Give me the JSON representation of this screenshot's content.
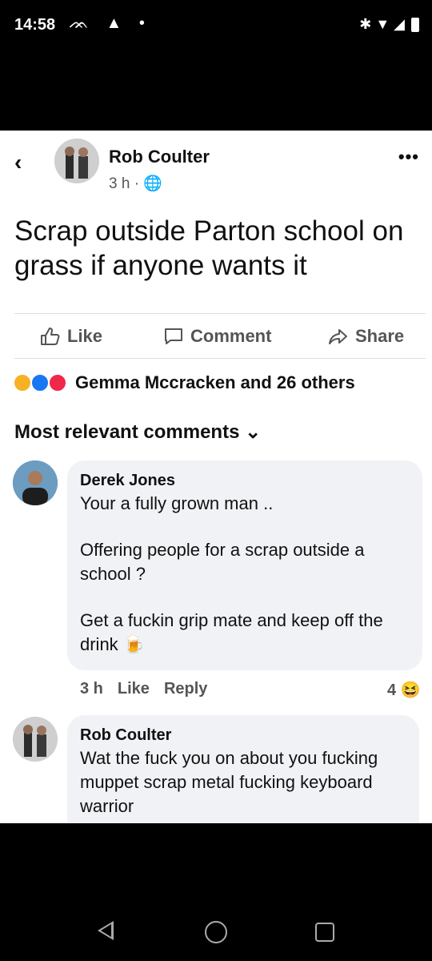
{
  "status": {
    "time": "14:58",
    "left_icons": "ᨏ ▲ •",
    "right_icons": "✱ ▼ ◢"
  },
  "post": {
    "author": "Rob Coulter",
    "meta": "3 h · 🌐",
    "text": "Scrap outside Parton school on grass if anyone wants it",
    "actions": {
      "like": "Like",
      "comment": "Comment",
      "share": "Share"
    },
    "reactions_text": "Gemma Mccracken and 26 others"
  },
  "comments_section": {
    "sort_label": "Most relevant comments ⌄"
  },
  "comments": [
    {
      "name": "Derek Jones",
      "lines": [
        "Your a fully grown man ..",
        "Offering people for a scrap outside a school ?",
        "Get a fuckin grip mate and keep off the drink 🍺"
      ],
      "time": "3 h",
      "like": "Like",
      "reply": "Reply",
      "reaction_count": "4 😆"
    },
    {
      "name": "Rob Coulter",
      "lines": [
        "Wat the fuck you on about you fucking muppet scrap metal fucking keyboard warrior"
      ]
    }
  ],
  "colors": {
    "accent": "#1877f2",
    "bubble": "#f0f2f5"
  },
  "icons": [
    "back-chevron-icon",
    "globe-icon",
    "more-icon",
    "like-icon",
    "comment-icon",
    "share-icon"
  ]
}
